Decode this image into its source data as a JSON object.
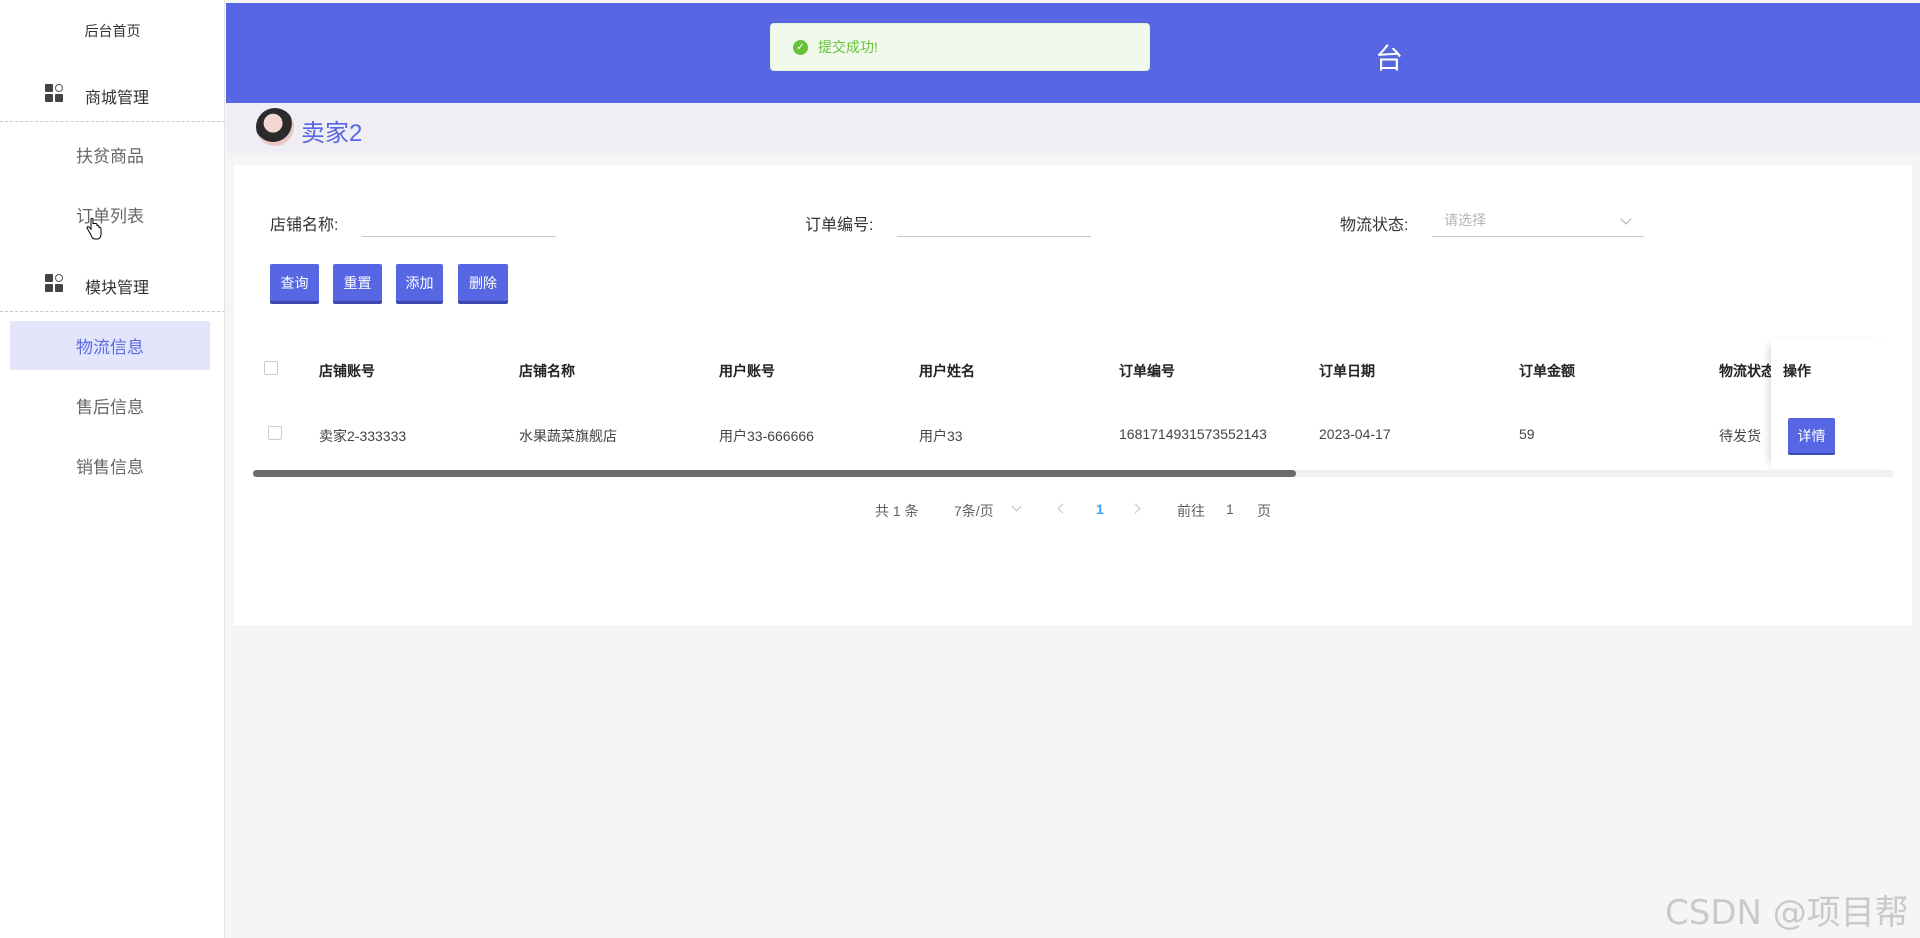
{
  "sidebar": {
    "home": "后台首页",
    "groups": [
      {
        "label": "商城管理",
        "icon": "grid-icon"
      },
      {
        "label": "模块管理",
        "icon": "grid-icon"
      }
    ],
    "items": [
      {
        "label": "扶贫商品"
      },
      {
        "label": "订单列表"
      },
      {
        "label": "物流信息",
        "active": true
      },
      {
        "label": "售后信息"
      },
      {
        "label": "销售信息"
      }
    ]
  },
  "header": {
    "title_partial": "台",
    "toast": "提交成功!",
    "color": "#5766e2"
  },
  "user": {
    "name": "卖家2"
  },
  "filters": {
    "shop_name_label": "店铺名称:",
    "order_no_label": "订单编号:",
    "logistics_label": "物流状态:",
    "logistics_placeholder": "请选择"
  },
  "buttons": {
    "query": "查询",
    "reset": "重置",
    "add": "添加",
    "delete": "删除"
  },
  "table": {
    "headers": [
      "店铺账号",
      "店铺名称",
      "用户账号",
      "用户姓名",
      "订单编号",
      "订单日期",
      "订单金额",
      "物流状态",
      "操作"
    ],
    "rows": [
      {
        "shop_account": "卖家2-333333",
        "shop_name": "水果蔬菜旗舰店",
        "user_account": "用户33-666666",
        "user_name": "用户33",
        "order_no": "1681714931573552143",
        "order_date": "2023-04-17",
        "amount": "59",
        "logistics": "待发货",
        "action": "详情"
      }
    ]
  },
  "pagination": {
    "total": "共 1 条",
    "page_size": "7条/页",
    "current": "1",
    "goto_prefix": "前往",
    "goto_value": "1",
    "goto_suffix": "页"
  },
  "watermark": "CSDN @项目帮"
}
